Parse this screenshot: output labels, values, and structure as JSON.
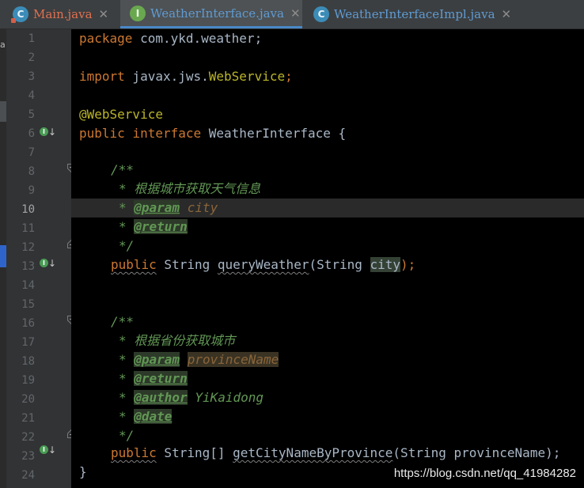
{
  "sidebar_letter": "a",
  "tabs": [
    {
      "label": "Main.java",
      "icon": "class-icon",
      "icon_letter": "C",
      "color": "#e07050",
      "active": false
    },
    {
      "label": "WeatherInterface.java",
      "icon": "interface-icon",
      "icon_letter": "I",
      "color": "#5f9bd3",
      "active": true
    },
    {
      "label": "WeatherInterfaceImpl.java",
      "icon": "class-icon",
      "icon_letter": "C",
      "color": "#5f9bd3",
      "active": false
    }
  ],
  "tab_close_glyph": "✕",
  "implemented_glyph": "I",
  "implemented_arrow": "↓",
  "line_numbers": [
    "1",
    "2",
    "3",
    "4",
    "5",
    "6",
    "7",
    "8",
    "9",
    "10",
    "11",
    "12",
    "13",
    "14",
    "15",
    "16",
    "17",
    "18",
    "19",
    "20",
    "21",
    "22",
    "23",
    "24"
  ],
  "current_line": 10,
  "code": {
    "l1": [
      "package",
      " com.ykd.weather;"
    ],
    "l3": [
      "import",
      " javax.jws.",
      "WebService",
      ";"
    ],
    "l5": "@WebService",
    "l6": [
      "public",
      " ",
      "interface",
      " WeatherInterface {"
    ],
    "l8": "/**",
    "l9": "* 根据城市获取天气信息",
    "l10": [
      "* ",
      "@param",
      " ",
      "city"
    ],
    "l11": [
      "* ",
      "@return"
    ],
    "l12": "*/",
    "l13": [
      "public",
      " String ",
      "queryWeather",
      "(String ",
      "city",
      ");"
    ],
    "l16": "/**",
    "l17": "* 根据省份获取城市",
    "l18": [
      "* ",
      "@param",
      " ",
      "provinceName"
    ],
    "l19": [
      "* ",
      "@return"
    ],
    "l20": [
      "* ",
      "@author",
      " YiKaidong"
    ],
    "l21": [
      "* ",
      "@date"
    ],
    "l22": "*/",
    "l23": [
      "public",
      " String[] ",
      "getCityNameByProvince",
      "(String provinceName);"
    ],
    "l24": "}"
  },
  "watermark": "https://blog.csdn.net/qq_41984282"
}
